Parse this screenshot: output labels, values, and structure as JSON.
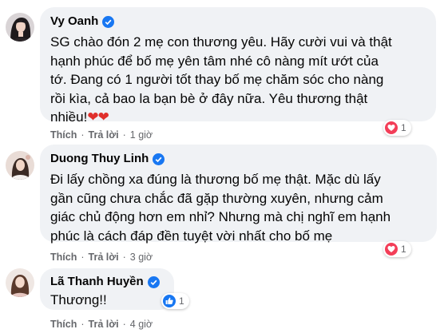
{
  "comments": [
    {
      "author": "Vy Oanh",
      "lines": [
        "SG chào đón 2 mẹ con thương yêu. Hãy cười vui và thật",
        "hạnh phúc để bố mẹ yên tâm nhé cô nàng mít ướt của",
        "tớ. Đang có 1 người tốt thay bố mẹ chăm sóc cho nàng",
        "rồi kìa, cả bao la bạn bè ở đây nữa. Yêu thương thật",
        "nhiều!"
      ],
      "emoji": "❤❤",
      "like_label": "Thích",
      "reply_label": "Trả lời",
      "time": "1 giờ",
      "reaction_icon": "heart-reaction-icon",
      "reaction_count": "1"
    },
    {
      "author": "Duong Thuy Linh",
      "lines": [
        "Đi lấy chồng xa đúng là thương bố mẹ thật. Mặc dù lấy",
        "gần cũng chưa chắc đã gặp thường xuyên, nhưng cảm",
        "giác chủ động hơn em nhỉ? Nhưng mà chị nghĩ em hạnh",
        "phúc là cách đáp đền tuyệt vời nhất cho bố mẹ"
      ],
      "like_label": "Thích",
      "reply_label": "Trả lời",
      "time": "3 giờ",
      "reaction_icon": "heart-reaction-icon",
      "reaction_count": "1"
    },
    {
      "author": "Lã Thanh Huyền",
      "lines": [
        "Thương!!"
      ],
      "like_label": "Thích",
      "reply_label": "Trả lời",
      "time": "4 giờ",
      "reaction_icon": "like-reaction-icon",
      "reaction_count": "1"
    }
  ],
  "separator": "·",
  "colors": {
    "bubble": "#f0f2f5",
    "verified": "#1877f2",
    "love": "#f33e58",
    "like": "#1877f2",
    "meta": "#65676b"
  }
}
